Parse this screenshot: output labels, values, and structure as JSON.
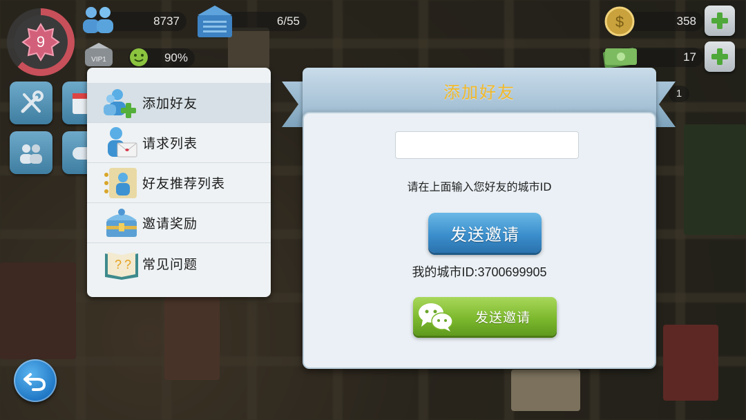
{
  "hud": {
    "level": "9",
    "population": "8737",
    "storage": "6/55",
    "happiness": "90%",
    "simcash": "358",
    "money": "17",
    "side_count": "1",
    "level_progress": 0.62,
    "happiness_level": 0.9
  },
  "menu": {
    "items": [
      {
        "label": "添加好友",
        "icon": "add-friend-icon",
        "active": true
      },
      {
        "label": "请求列表",
        "icon": "request-list-icon",
        "active": false
      },
      {
        "label": "好友推荐列表",
        "icon": "friend-recommend-icon",
        "active": false
      },
      {
        "label": "邀请奖励",
        "icon": "invite-reward-chest-icon",
        "active": false
      },
      {
        "label": "常见问题",
        "icon": "faq-book-icon",
        "active": false
      }
    ]
  },
  "dialog": {
    "title": "添加好友",
    "input_value": "",
    "input_placeholder": "",
    "hint": "请在上面输入您好友的城市ID",
    "send_label": "发送邀请",
    "my_city_id": "我的城市ID:3700699905",
    "wechat_label": "发送邀请"
  },
  "colors": {
    "title_gold": "#f2b929",
    "send_blue": "#3b8fcc",
    "wechat_green": "#7db92e",
    "level_ring": "#c8505a"
  }
}
